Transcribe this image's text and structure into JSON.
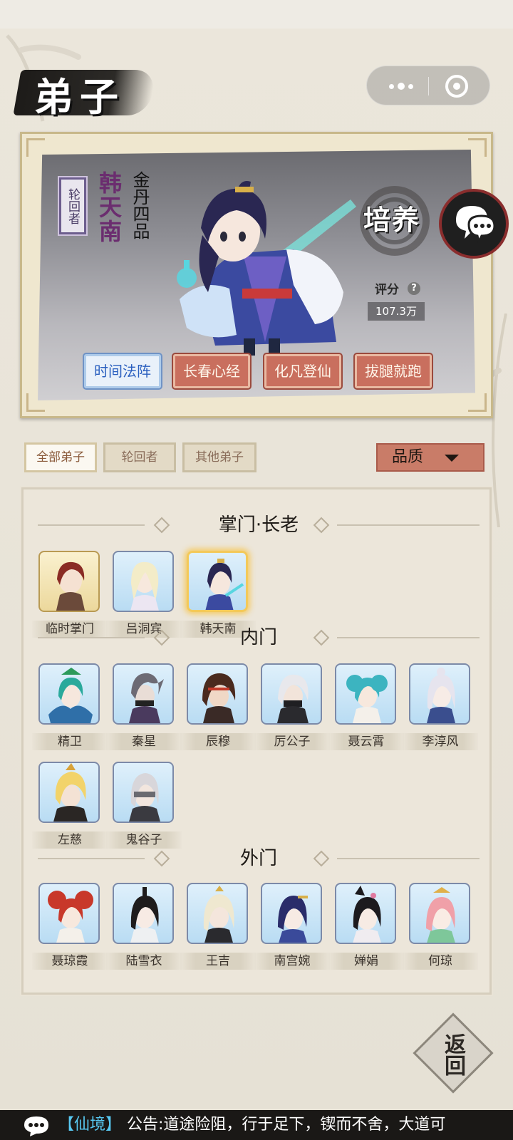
{
  "page": {
    "title": "弟子"
  },
  "capsule": {
    "more_icon": "more-dots-icon",
    "close_icon": "close-circle-icon"
  },
  "hero": {
    "tag": "轮回者",
    "name": "韩天南",
    "rank": "金丹四品",
    "cultivate_label": "培养",
    "score_label": "评分",
    "score_help": "?",
    "score_value": "107.3万",
    "skills": [
      "时间法阵",
      "长春心经",
      "化凡登仙",
      "拔腿就跑"
    ],
    "selected_skill_index": 0
  },
  "filters": {
    "tabs": [
      "全部弟子",
      "轮回者",
      "其他弟子"
    ],
    "active_index": 0,
    "sort_label": "品质"
  },
  "sections": [
    {
      "title": "掌门·长老",
      "members": [
        "临时掌门",
        "吕洞宾",
        "韩天南"
      ]
    },
    {
      "title": "内门",
      "members": [
        "精卫",
        "秦星",
        "辰穆",
        "厉公子",
        "聂云霄",
        "李淳风",
        "左慈",
        "鬼谷子"
      ]
    },
    {
      "title": "外门",
      "members": [
        "聂琼霞",
        "陆雪衣",
        "王吉",
        "南宫婉",
        "婵娟",
        "何琼"
      ]
    }
  ],
  "back_label": "返回",
  "ticker": {
    "channel": "【仙境】",
    "text": "公告:道途险阻，行于足下，锲而不舍，大道可"
  },
  "colors": {
    "skill_selected": "#e9f1fa",
    "skill_normal": "#c96f5e",
    "ticker_channel": "#58c9f2",
    "selected_glow": "#f3c95a"
  }
}
